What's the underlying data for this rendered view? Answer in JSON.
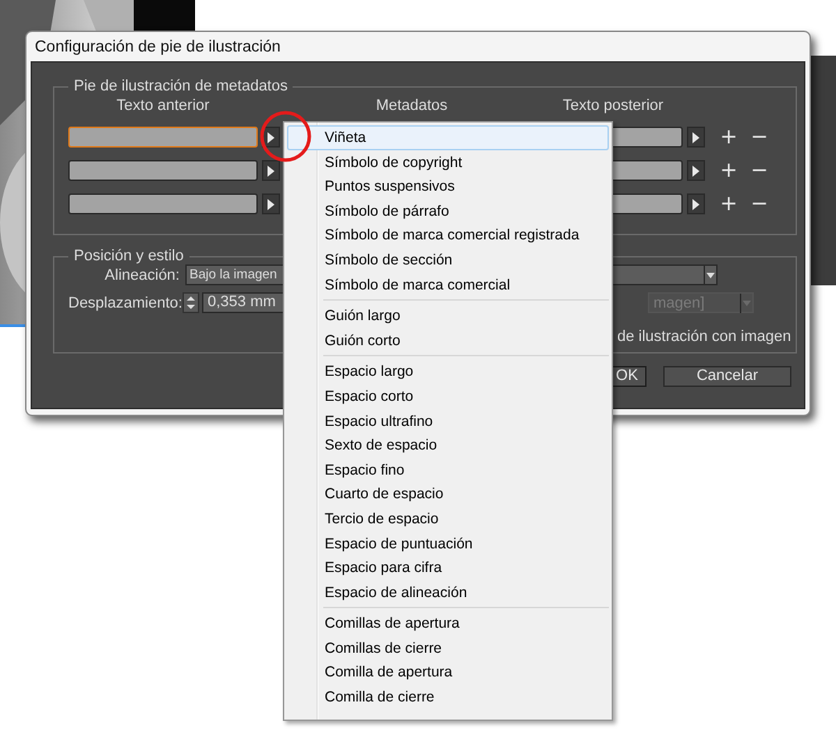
{
  "window": {
    "title": "Configuración de pie de ilustración"
  },
  "metadata_caption": {
    "legend": "Pie de ilustración de metadatos",
    "columns": [
      "Texto anterior",
      "Metadatos",
      "Texto posterior"
    ],
    "rows": [
      {
        "focused": true,
        "plus": "+",
        "minus": "−"
      },
      {
        "focused": false,
        "plus": "+",
        "minus": "−"
      },
      {
        "focused": false,
        "plus": "+",
        "minus": "−"
      }
    ]
  },
  "position_style": {
    "legend": "Posición y estilo",
    "alignment_label": "Alineación:",
    "alignment_value": "Bajo la imagen",
    "offset_label": "Desplazamiento:",
    "offset_value": "0,353 mm",
    "style_value": "magen]",
    "style_disabled": true,
    "group_label": "de ilustración con imagen"
  },
  "buttons": [
    {
      "label": "OK",
      "default": true
    },
    {
      "label": "Cancelar",
      "default": false
    }
  ],
  "menu": {
    "groups": [
      [
        {
          "label": "Viñeta",
          "selected": true
        },
        {
          "label": "Símbolo de copyright",
          "selected": false
        },
        {
          "label": "Puntos suspensivos",
          "selected": false
        },
        {
          "label": "Símbolo de párrafo",
          "selected": false
        },
        {
          "label": "Símbolo de marca comercial registrada",
          "selected": false
        },
        {
          "label": "Símbolo de sección",
          "selected": false
        },
        {
          "label": "Símbolo de marca comercial",
          "selected": false
        }
      ],
      [
        {
          "label": "Guión largo",
          "selected": false
        },
        {
          "label": "Guión corto",
          "selected": false
        }
      ],
      [
        {
          "label": "Espacio largo",
          "selected": false
        },
        {
          "label": "Espacio corto",
          "selected": false
        },
        {
          "label": "Espacio ultrafino",
          "selected": false
        },
        {
          "label": "Sexto de espacio",
          "selected": false
        },
        {
          "label": "Espacio fino",
          "selected": false
        },
        {
          "label": "Cuarto de espacio",
          "selected": false
        },
        {
          "label": "Tercio de espacio",
          "selected": false
        },
        {
          "label": "Espacio de puntuación",
          "selected": false
        },
        {
          "label": "Espacio para cifra",
          "selected": false
        },
        {
          "label": "Espacio de alineación",
          "selected": false
        }
      ],
      [
        {
          "label": "Comillas de apertura",
          "selected": false
        },
        {
          "label": "Comillas de cierre",
          "selected": false
        },
        {
          "label": "Comilla de apertura",
          "selected": false
        },
        {
          "label": "Comilla de cierre",
          "selected": false
        }
      ]
    ]
  }
}
